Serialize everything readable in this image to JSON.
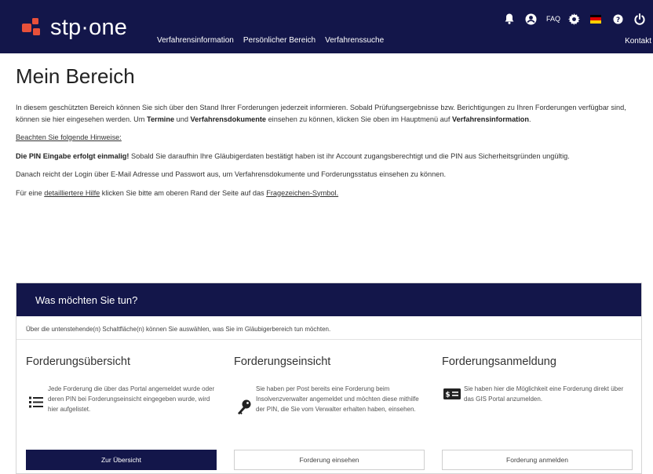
{
  "brand": {
    "logo_text": "stp·one"
  },
  "nav": {
    "items": [
      "Verfahrensinformation",
      "Persönlicher Bereich",
      "Verfahrenssuche"
    ],
    "faq_label": "FAQ",
    "kontakt_label": "Kontakt"
  },
  "icons": [
    "bell-icon",
    "user-icon",
    "gear-icon",
    "flag-de-icon",
    "help-icon",
    "power-icon"
  ],
  "colors": {
    "navy": "#13164a",
    "logo_accent": "#e8503a",
    "flag": [
      "#000000",
      "#dd0000",
      "#ffce00"
    ]
  },
  "page": {
    "title": "Mein Bereich",
    "intro": {
      "p1_a": "In diesem geschützten Bereich können Sie sich über den Stand Ihrer Forderungen jederzeit informieren. Sobald Prüfungsergebnisse bzw. Berichtigungen zu Ihren Forderungen verfügbar sind, können sie hier eingesehen werden. Um ",
      "p1_termine": "Termine",
      "p1_b": " und ",
      "p1_dokumente": "Verfahrensdokumente",
      "p1_c": " einsehen zu können, klicken Sie oben im Hauptmenü auf ",
      "p1_info": "Verfahrensinformation",
      "p1_d": ".",
      "hint_heading": "Beachten Sie folgende Hinweise:",
      "p2_bold": "Die PIN Eingabe erfolgt einmalig!",
      "p2_text": " Sobald Sie daraufhin Ihre Gläubigerdaten bestätigt haben ist ihr Account zugangsberechtigt und die PIN aus Sicherheitsgründen ungültig.",
      "p3": "Danach reicht der Login über E-Mail Adresse und Passwort aus, um Verfahrensdokumente und Forderungsstatus einsehen zu können.",
      "p4_a": "Für eine ",
      "p4_link1": "detailliertere Hilfe",
      "p4_b": " klicken Sie bitte am oberen Rand der Seite auf das ",
      "p4_link2": "Fragezeichen-Symbol."
    }
  },
  "card": {
    "heading": "Was möchten Sie tun?",
    "subtext": "Über die untenstehende(n) Schaltfläche(n) können Sie auswählen, was Sie im Gläubigerbereich tun möchten.",
    "options": [
      {
        "title": "Forderungsübersicht",
        "icon": "list-icon",
        "text": "Jede Forderung die über das Portal angemeldet wurde oder deren PIN bei Forderungseinsicht eingegeben wurde, wird hier aufgelistet.",
        "button": "Zur Übersicht"
      },
      {
        "title": "Forderungseinsicht",
        "icon": "key-icon",
        "text": "Sie haben per Post bereits eine Forderung beim Insolvenzverwalter angemeldet und möchten diese mithilfe der PIN, die Sie vom Verwalter erhalten haben, einsehen.",
        "button": "Forderung einsehen"
      },
      {
        "title": "Forderungsanmeldung",
        "icon": "money-card-icon",
        "text": "Sie haben hier die Möglichkeit eine Forderung direkt über das GIS Portal anzumelden.",
        "button": "Forderung anmelden"
      }
    ]
  }
}
